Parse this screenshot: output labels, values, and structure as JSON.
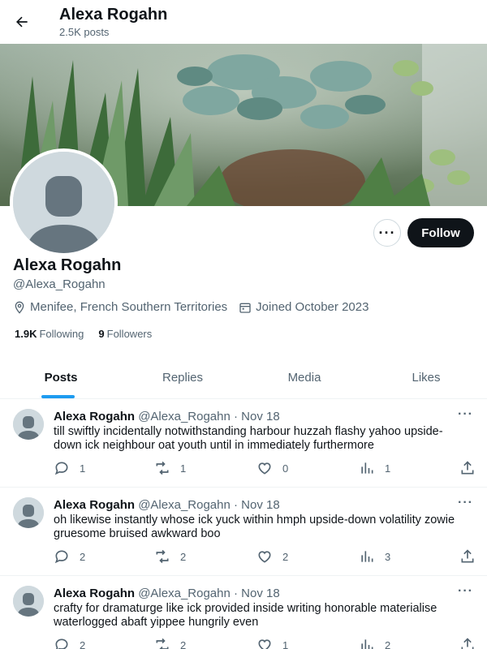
{
  "header": {
    "name": "Alexa Rogahn",
    "post_count": "2.5K posts"
  },
  "profile": {
    "name": "Alexa Rogahn",
    "handle": "@Alexa_Rogahn",
    "location": "Menifee, French Southern Territories",
    "joined": "Joined October 2023",
    "following_count": "1.9K",
    "following_label": "Following",
    "followers_count": "9",
    "followers_label": "Followers",
    "more_label": "···",
    "follow_label": "Follow"
  },
  "tabs": [
    {
      "label": "Posts",
      "active": true
    },
    {
      "label": "Replies",
      "active": false
    },
    {
      "label": "Media",
      "active": false
    },
    {
      "label": "Likes",
      "active": false
    }
  ],
  "posts": [
    {
      "author": "Alexa Rogahn",
      "meta": "@Alexa_Rogahn · Nov 18",
      "text": "till swiftly incidentally notwithstanding harbour huzzah flashy yahoo upside-down ick neighbour oat youth until in immediately furthermore",
      "replies": "1",
      "reposts": "1",
      "likes": "0",
      "views": "1"
    },
    {
      "author": "Alexa Rogahn",
      "meta": "@Alexa_Rogahn · Nov 18",
      "text": "oh likewise instantly whose ick yuck within hmph upside-down volatility zowie gruesome bruised awkward boo",
      "replies": "2",
      "reposts": "2",
      "likes": "2",
      "views": "3"
    },
    {
      "author": "Alexa Rogahn",
      "meta": "@Alexa_Rogahn · Nov 18",
      "text": "crafty for dramaturge like ick provided inside writing honorable materialise waterlogged abaft yippee hungrily even",
      "replies": "2",
      "reposts": "2",
      "likes": "1",
      "views": "2"
    }
  ],
  "post_menu_label": "···",
  "colors": {
    "accent": "#1d9bf0",
    "text": "#0f1419",
    "secondary": "#536471",
    "follow_bg": "#0f1419"
  }
}
